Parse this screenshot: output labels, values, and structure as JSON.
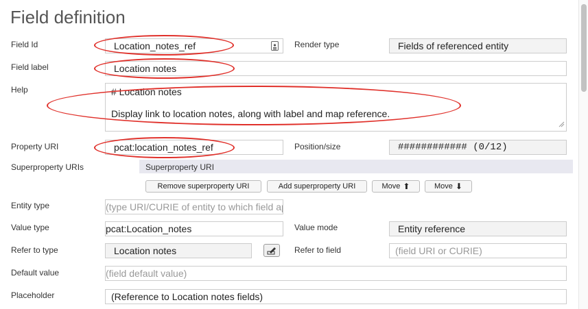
{
  "page_title": "Field definition",
  "fields": {
    "field_id": {
      "label": "Field Id",
      "value": "Location_notes_ref"
    },
    "render_type": {
      "label": "Render type",
      "value": "Fields of referenced entity"
    },
    "field_label": {
      "label": "Field label",
      "value": "Location notes"
    },
    "help": {
      "label": "Help",
      "line1": "# Location notes",
      "line2": "Display link to location notes, along with label and map reference."
    },
    "property_uri": {
      "label": "Property URI",
      "value": "pcat:location_notes_ref"
    },
    "position_size": {
      "label": "Position/size",
      "value": "############ (0/12)"
    },
    "superproperty": {
      "label": "Superproperty URIs",
      "header": "Superproperty URI"
    },
    "entity_type": {
      "label": "Entity type",
      "placeholder": "(type URI/CURIE of entity to which field applies)"
    },
    "value_type": {
      "label": "Value type",
      "value": "pcat:Location_notes"
    },
    "value_mode": {
      "label": "Value mode",
      "value": "Entity reference"
    },
    "refer_to_type": {
      "label": "Refer to type",
      "value": "Location notes"
    },
    "refer_to_field": {
      "label": "Refer to field",
      "placeholder": "(field URI or CURIE)"
    },
    "default_value": {
      "label": "Default value",
      "placeholder": "(field default value)"
    },
    "placeholder": {
      "label": "Placeholder",
      "value": "(Reference to Location notes fields)"
    }
  },
  "buttons": {
    "remove_superproperty": "Remove superproperty URI",
    "add_superproperty": "Add superproperty URI",
    "move_up": "Move",
    "move_down": "Move"
  },
  "colors": {
    "annotation": "#e0302a",
    "grey_field": "#f3f3f3",
    "superproperty_bar": "#e8e8f0"
  },
  "icons": [
    "id-card-icon",
    "edit-icon",
    "arrow-up-icon",
    "arrow-down-icon",
    "resize-grip-icon"
  ]
}
